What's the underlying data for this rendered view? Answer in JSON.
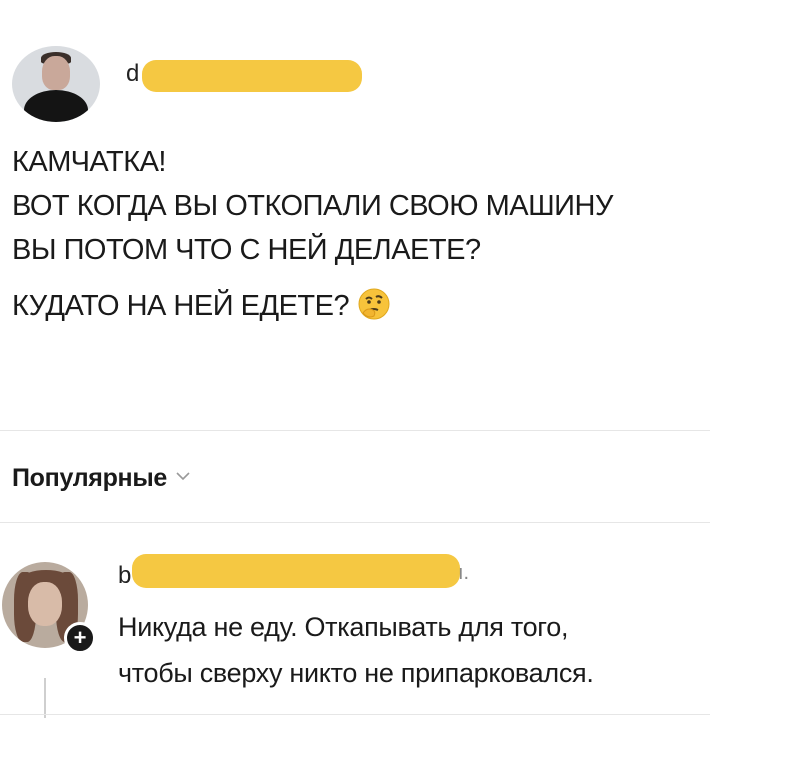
{
  "post": {
    "author_visible_fragment": "d",
    "lines": [
      "КАМЧАТКА!",
      "ВОТ КОГДА ВЫ ОТКОПАЛИ СВОЮ МАШИНУ",
      "ВЫ ПОТОМ ЧТО С НЕЙ ДЕЛАЕТЕ?",
      "КУДАТО НА НЕЙ ЕДЕТЕ?"
    ],
    "emoji": "thinking-face"
  },
  "comments_sort": {
    "label": "Популярные",
    "icon": "chevron-down-icon"
  },
  "comment": {
    "author_visible_fragment": "b",
    "author_trailing_fragment": "ı.",
    "lines": [
      "Никуда не еду. Откапывать для того,",
      "чтобы сверху никто не припарковался."
    ],
    "badge_symbol": "+"
  },
  "colors": {
    "redaction": "#f5c842",
    "divider": "#e6e6e6",
    "text": "#1a1a1a"
  }
}
